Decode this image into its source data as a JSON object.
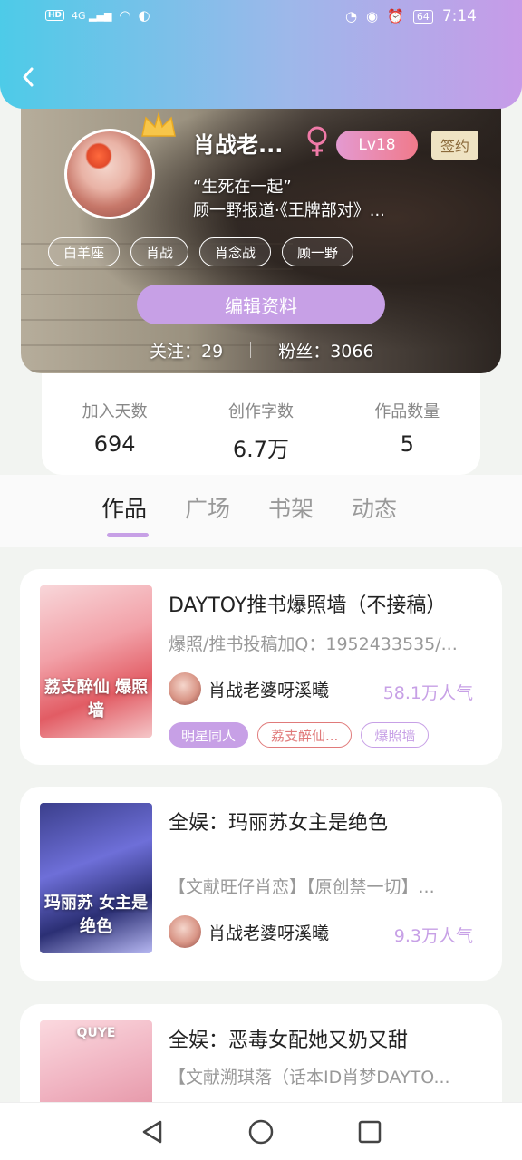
{
  "status_bar": {
    "network": "HD",
    "signal": "4G",
    "battery": "64",
    "time": "7:14"
  },
  "profile": {
    "name": "肖战老...",
    "level": "Lv18",
    "signed_badge": "签约",
    "bio_line1": "“生死在一起”",
    "bio_line2": "顾一野报道·《王牌部对》...",
    "tags": [
      "白羊座",
      "肖战",
      "肖念战",
      "顾一野"
    ],
    "edit_button": "编辑资料",
    "following_label": "关注：29",
    "followers_label": "粉丝：3066"
  },
  "stats": [
    {
      "label": "加入天数",
      "value": "694"
    },
    {
      "label": "创作字数",
      "value": "6.7万"
    },
    {
      "label": "作品数量",
      "value": "5"
    }
  ],
  "tabs": [
    {
      "label": "作品",
      "active": true
    },
    {
      "label": "广场",
      "active": false
    },
    {
      "label": "书架",
      "active": false
    },
    {
      "label": "动态",
      "active": false
    }
  ],
  "works": [
    {
      "title": "DAYTOY推书爆照墙（不接稿）",
      "desc": "爆照/推书投稿加Q：1952433535/...",
      "author": "肖战老婆呀溪曦",
      "popularity": "58.1万人气",
      "cover_text": "荔支醉仙 爆照墙",
      "chips": [
        "明星同人",
        "荔支醉仙...",
        "爆照墙"
      ]
    },
    {
      "title": "全娱：玛丽苏女主是绝色",
      "desc": "【文献旺仔肖恋】【原创禁一切】...",
      "author": "肖战老婆呀溪曦",
      "popularity": "9.3万人气",
      "cover_text": "玛丽苏 女主是绝色"
    },
    {
      "title": "全娱：恶毒女配她又奶又甜",
      "desc": "【文献溯琪落（话本ID肖梦DAYTO...",
      "cover_text": "QUYE"
    }
  ],
  "colors": {
    "accent": "#c7a0e6",
    "header_gradient_start": "#4dcbe8",
    "header_gradient_end": "#c79be8"
  }
}
